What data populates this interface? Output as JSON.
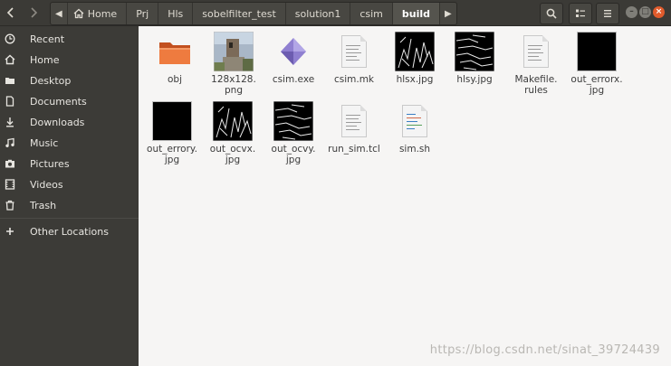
{
  "nav": {
    "back_icon": "chevron-left-icon",
    "forward_icon": "chevron-right-icon"
  },
  "breadcrumbs": [
    "Home",
    "Prj",
    "Hls",
    "sobelfilter_test",
    "solution1",
    "csim",
    "build"
  ],
  "toolbar": {
    "search_icon": "search-icon",
    "view_icon": "list-view-icon",
    "menu_icon": "hamburger-icon"
  },
  "window_controls": {
    "minimize": "–",
    "maximize": "□",
    "close": "×"
  },
  "sidebar": {
    "items": [
      {
        "label": "Recent",
        "icon": "clock-icon"
      },
      {
        "label": "Home",
        "icon": "home-icon"
      },
      {
        "label": "Desktop",
        "icon": "folder-icon"
      },
      {
        "label": "Documents",
        "icon": "document-icon"
      },
      {
        "label": "Downloads",
        "icon": "download-icon"
      },
      {
        "label": "Music",
        "icon": "music-icon"
      },
      {
        "label": "Pictures",
        "icon": "camera-icon"
      },
      {
        "label": "Videos",
        "icon": "video-icon"
      },
      {
        "label": "Trash",
        "icon": "trash-icon"
      },
      {
        "label": "Other Locations",
        "icon": "plus-icon"
      }
    ]
  },
  "files": [
    {
      "name": "obj",
      "type": "folder"
    },
    {
      "name": "128x128.\npng",
      "type": "photo"
    },
    {
      "name": "csim.exe",
      "type": "exe"
    },
    {
      "name": "csim.mk",
      "type": "text"
    },
    {
      "name": "hlsx.jpg",
      "type": "edge"
    },
    {
      "name": "hlsy.jpg",
      "type": "edge"
    },
    {
      "name": "Makefile.\nrules",
      "type": "text"
    },
    {
      "name": "out_errorx.\njpg",
      "type": "black"
    },
    {
      "name": "out_errory.\njpg",
      "type": "black"
    },
    {
      "name": "out_ocvx.\njpg",
      "type": "edge"
    },
    {
      "name": "out_ocvy.\njpg",
      "type": "edge"
    },
    {
      "name": "run_sim.tcl",
      "type": "text"
    },
    {
      "name": "sim.sh",
      "type": "script"
    }
  ],
  "watermark": "https://blog.csdn.net/sinat_39724439",
  "colors": {
    "accent": "#e05b2c",
    "sidebar_bg": "#3c3b37",
    "content_bg": "#f6f5f4"
  }
}
